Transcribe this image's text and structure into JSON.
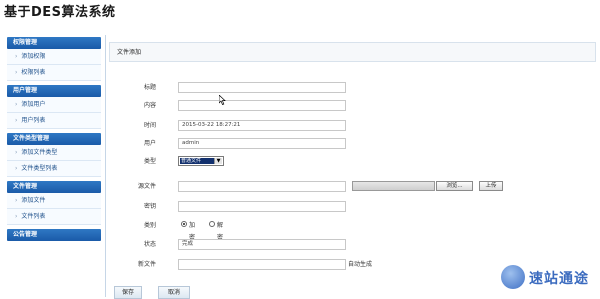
{
  "app": {
    "title": "基于DES算法系统"
  },
  "sidebar": {
    "groups": [
      {
        "header": "权限管理",
        "items": [
          "添加权限",
          "权限列表"
        ]
      },
      {
        "header": "用户管理",
        "items": [
          "添加用户",
          "用户列表"
        ]
      },
      {
        "header": "文件类型管理",
        "items": [
          "添加文件类型",
          "文件类型列表"
        ]
      },
      {
        "header": "文件管理",
        "items": [
          "添加文件",
          "文件列表"
        ]
      },
      {
        "header": "公告管理",
        "items": []
      }
    ]
  },
  "panel": {
    "title": "文件添加"
  },
  "form": {
    "title_label": "标题",
    "title_value": "",
    "content_label": "内容",
    "content_value": "",
    "time_label": "时间",
    "time_value": "2015-03-22 18:27:21",
    "user_label": "用户",
    "user_value": "admin",
    "type_label": "类型",
    "type_value": "普通文件",
    "source_label": "源文件",
    "source_value": "",
    "browse_label": "浏览...",
    "upload_label": "上传",
    "key_label": "密钥",
    "key_value": "",
    "category_label": "类别",
    "encrypt_label": "加密",
    "decrypt_label": "解密",
    "selected_category": "加密",
    "status_label": "状态",
    "status_value": "完成",
    "new_file_label": "新文件",
    "new_file_value": "",
    "auto_hint": "自动生成",
    "save_label": "保存",
    "cancel_label": "取消"
  },
  "watermark": {
    "text": "速站通途"
  },
  "colors": {
    "sidebar_header": "#1a5aa8",
    "link": "#1d4f8a",
    "select_highlight": "#12306e"
  }
}
